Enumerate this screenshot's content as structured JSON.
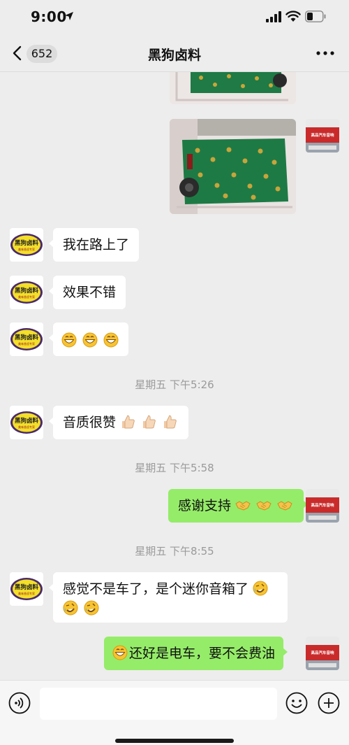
{
  "status": {
    "time": "9:00"
  },
  "header": {
    "unread_count": "652",
    "title": "黑狗卤料"
  },
  "contact": {
    "avatar_text": "黑狗卤料",
    "avatar_subtext": "美味香卤专家"
  },
  "me": {
    "avatar_sign": "高品汽车音响"
  },
  "messages": {
    "m1": "我在路上了",
    "m2": "效果不错",
    "ts1": "星期五 下午5:26",
    "m4_text": "音质很赞",
    "ts2": "星期五 下午5:58",
    "m5_text": "感谢支持",
    "ts3": "星期五 下午8:55",
    "m6_text": "感觉不是车了，是个迷你音箱了",
    "m7_text": "还好是电车，要不会费油"
  },
  "icons": {
    "grin": "grinning-face",
    "thumbs": "thumbs-up",
    "handshake": "handshake",
    "laughcry": "rolling-on-floor-laughing"
  },
  "input": {
    "placeholder": ""
  }
}
